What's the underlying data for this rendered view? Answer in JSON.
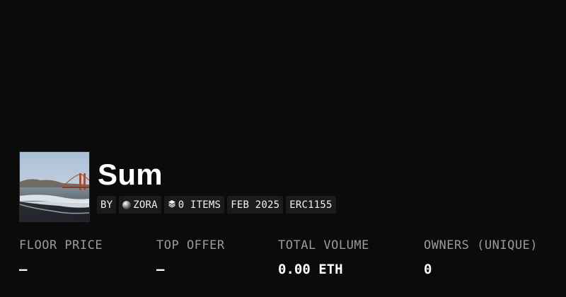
{
  "collection": {
    "title": "Sum",
    "thumbnail_icon": "beach-bridge-photo"
  },
  "chips": {
    "by_label": "BY",
    "creator": "ZORA",
    "creator_icon": "zora-orb-icon",
    "items_count_label": "0 ITEMS",
    "items_icon": "layers-icon",
    "date": "FEB 2025",
    "standard": "ERC1155"
  },
  "stats": [
    {
      "label": "FLOOR PRICE",
      "value": "—"
    },
    {
      "label": "TOP OFFER",
      "value": "—"
    },
    {
      "label": "TOTAL VOLUME",
      "value": "0.00 ETH"
    },
    {
      "label": "OWNERS (UNIQUE)",
      "value": "0"
    }
  ],
  "colors": {
    "background": "#0b0b0c",
    "chip_bg": "#1b1b1c",
    "label_gray": "#9a9a9a"
  }
}
